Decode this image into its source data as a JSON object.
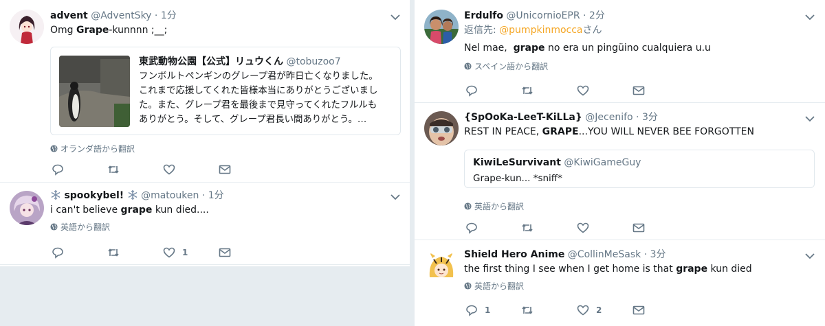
{
  "left": {
    "t1": {
      "name": "advent",
      "handle": "@AdventSky",
      "dot": "·",
      "time": "1分",
      "text_pre": "Omg ",
      "text_bold": "Grape",
      "text_post": "-kunnnn ;__;",
      "quote": {
        "name": "東武動物公園【公式】リュウくん",
        "handle": "@tobuzoo7",
        "lines": [
          "フンボルトペンギンのグレープ君が昨日亡くなりました。",
          "これまで応援してくれた皆様本当にありがとうございまし",
          "た。また、グレープ君を最後まで見守ってくれたフルルも",
          "ありがとう。そして、グレープ君長い間ありがとう。…"
        ]
      },
      "translate": "オランダ語から翻訳"
    },
    "t2": {
      "name": "spookybel!",
      "handle": "@matouken",
      "dot": "·",
      "time": "1分",
      "text_pre": "i can't believe ",
      "text_bold": "grape",
      "text_post": " kun died....",
      "translate": "英語から翻訳",
      "like_count": "1"
    }
  },
  "right": {
    "t1": {
      "name": "Erdulfo",
      "handle": "@UnicornioEPR",
      "dot": "·",
      "time": "2分",
      "reply_label": "返信先:",
      "reply_link": "@pumpkinmocca",
      "reply_suffix": "さん",
      "text_pre": "Nel mae,  ",
      "text_bold": "grape",
      "text_post": " no era un pingüino cualquiera u.u",
      "translate": "スペイン語から翻訳"
    },
    "t2": {
      "name": "{SpOoKa-LeeT-KiLLa}",
      "handle": "@Jecenifo",
      "dot": "·",
      "time": "3分",
      "text_pre": "REST IN PEACE, ",
      "text_bold": "GRAPE",
      "text_post": "...YOU WILL NEVER BEE FORGOTTEN",
      "quote": {
        "name": "KiwiLeSurvivant",
        "handle": "@KiwiGameGuy",
        "text": "Grape-kun... *sniff*"
      },
      "translate": "英語から翻訳"
    },
    "t3": {
      "name": "Shield Hero Anime",
      "handle": "@CollinMeSask",
      "dot": "·",
      "time": "3分",
      "text_pre": "the first thing I see when I get home is that ",
      "text_bold": "grape",
      "text_post": " kun died",
      "translate": "英語から翻訳",
      "reply_count": "1",
      "like_count": "2"
    }
  },
  "icons": [
    "reply-icon",
    "retweet-icon",
    "like-icon",
    "dm-icon",
    "chevron-down-icon",
    "globe-icon",
    "snowflake-icon"
  ],
  "colors": {
    "link": "#f5a623",
    "muted": "#657786",
    "border": "#e6ecf0"
  }
}
